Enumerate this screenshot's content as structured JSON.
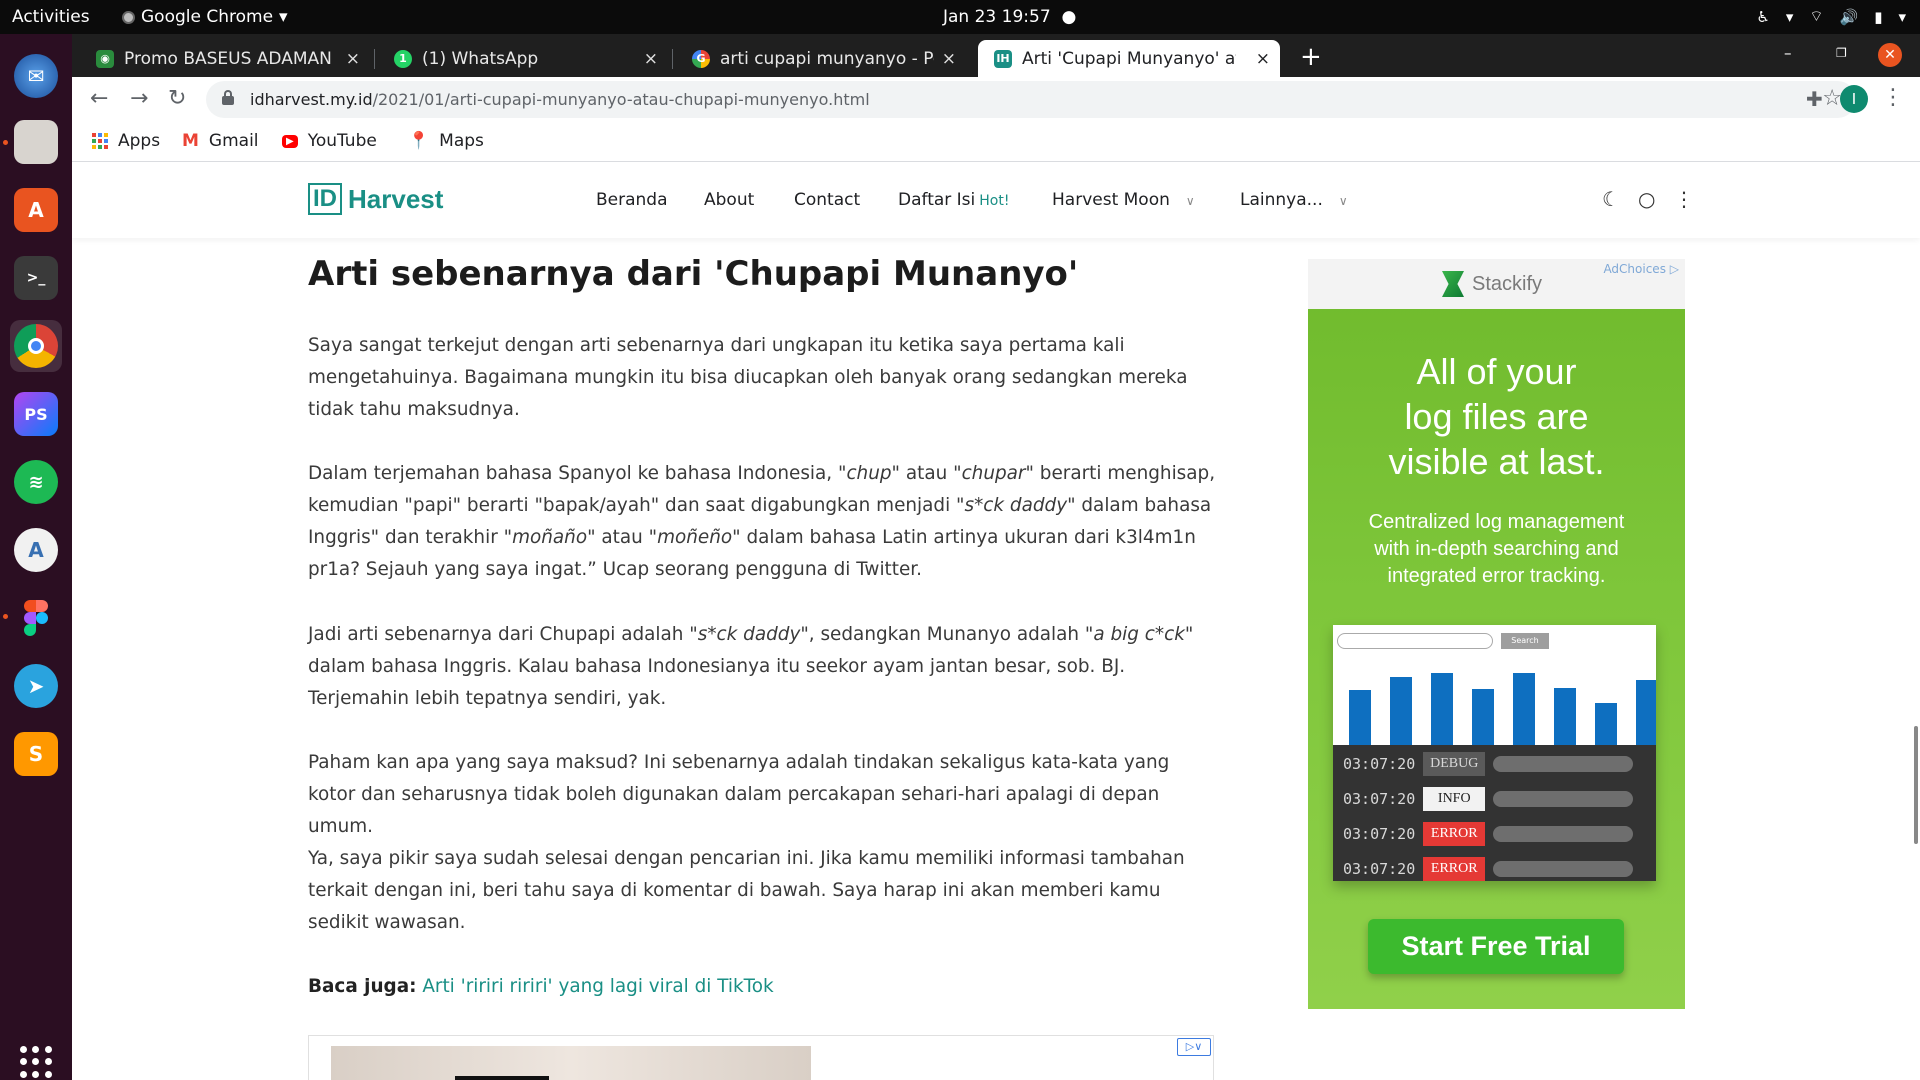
{
  "system": {
    "activities": "Activities",
    "app_name": "Google Chrome",
    "clock": "Jan 23  19:57"
  },
  "browser": {
    "tabs": [
      {
        "title": "Promo BASEUS ADAMAN",
        "close": "×"
      },
      {
        "title": "(1) WhatsApp",
        "close": "×"
      },
      {
        "title": "arti cupapi munyanyo - Pe",
        "close": "×"
      },
      {
        "title": "Arti 'Cupapi Munyanyo' at",
        "close": "×"
      }
    ],
    "new_tab": "+",
    "url_host": "idharvest.my.id",
    "url_path": "/2021/01/arti-cupapi-munyanyo-atau-chupapi-munyenyo.html",
    "profile_initial": "I",
    "bookmarks": [
      "Apps",
      "Gmail",
      "YouTube",
      "Maps"
    ]
  },
  "site": {
    "logo_id": "ID",
    "logo_name": "Harvest",
    "nav": [
      "Beranda",
      "About",
      "Contact",
      "Daftar Isi",
      "Harvest Moon",
      "Lainnya..."
    ],
    "nav_hot": "Hot!"
  },
  "article": {
    "heading": "Arti sebenarnya dari 'Chupapi Munanyo'",
    "p1": "Saya sangat terkejut dengan arti sebenarnya dari ungkapan itu ketika saya pertama kali mengetahuinya. Bagaimana mungkin itu bisa diucapkan oleh banyak orang sedangkan mereka tidak tahu maksudnya.",
    "p2": [
      "Dalam terjemahan bahasa Spanyol ke bahasa Indonesia, \"",
      "chup",
      "\" atau \"",
      "chupar",
      "\" berarti menghisap, kemudian \"papi\" berarti \"bapak/ayah\" dan saat digabungkan menjadi \"",
      "s*ck daddy",
      "\" dalam bahasa Inggris\" dan terakhir \"",
      "moñaño",
      "\" atau \"",
      "moñeño",
      "\" dalam bahasa Latin artinya ukuran dari k3l4m1n pr1a? Sejauh yang saya ingat.” Ucap seorang pengguna di Twitter."
    ],
    "p3": [
      "Jadi arti sebenarnya dari Chupapi adalah \"",
      "s*ck daddy",
      "\", sedangkan Munanyo adalah \"",
      "a big c*ck",
      "\" dalam bahasa Inggris. Kalau bahasa Indonesianya itu seekor ayam jantan besar, sob. BJ. Terjemahin lebih tepatnya sendiri, yak."
    ],
    "p4": "Paham kan apa yang saya maksud? Ini sebenarnya adalah tindakan sekaligus kata-kata yang kotor dan seharusnya tidak boleh digunakan dalam percakapan sehari-hari apalagi di depan umum.",
    "p5": "Ya, saya pikir saya sudah selesai dengan pencarian ini. Jika kamu memiliki informasi tambahan terkait dengan ini, beri tahu saya di komentar di bawah. Saya harap ini akan memberi kamu sedikit wawasan.",
    "baca_label": "Baca juga:",
    "baca_link": "Arti 'ririri ririri' yang lagi viral di TikTok"
  },
  "ad": {
    "brand": "Stackify",
    "adchoices": "AdChoices",
    "headline": [
      "All of your",
      "log files are",
      "visible at last."
    ],
    "subline": [
      "Centralized log management",
      "with in-depth searching and",
      "integrated error tracking."
    ],
    "search_button": "Search",
    "bar_values": [
      0.42,
      0.52,
      0.55,
      0.43,
      0.55,
      0.44,
      0.32,
      0.5
    ],
    "logs": [
      {
        "time": "03:07:20",
        "level": "DEBUG"
      },
      {
        "time": "03:07:20",
        "level": "INFO"
      },
      {
        "time": "03:07:20",
        "level": "ERROR"
      },
      {
        "time": "03:07:20",
        "level": "ERROR"
      }
    ],
    "cta": "Start Free Trial"
  }
}
